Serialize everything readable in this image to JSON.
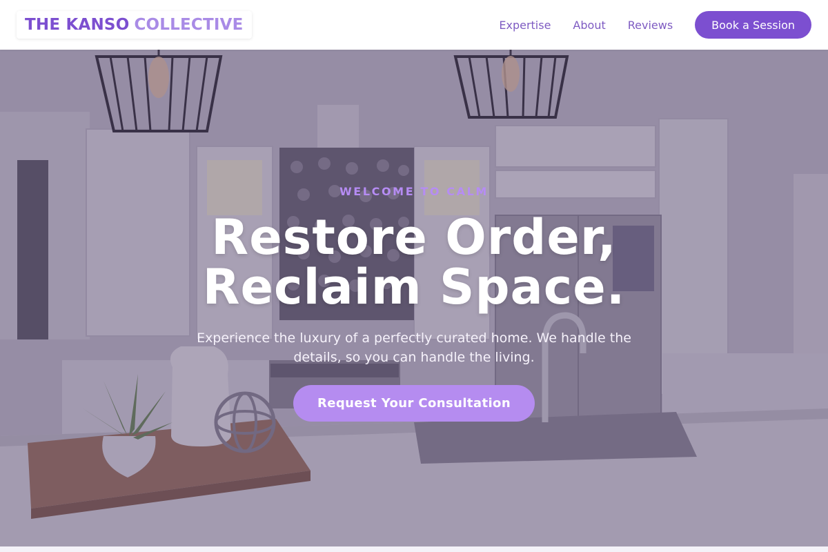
{
  "brand": {
    "name_part1": "THE KANSO",
    "name_part2": "COLLECTIVE",
    "primary_color": "#7c4fd0",
    "secondary_color": "#a98be6"
  },
  "nav": {
    "items": [
      {
        "label": "Expertise"
      },
      {
        "label": "About"
      },
      {
        "label": "Reviews"
      }
    ],
    "cta_label": "Book a Session"
  },
  "hero": {
    "eyebrow": "WELCOME TO CALM",
    "headline_line1": "Restore Order,",
    "headline_line2": "Reclaim Space.",
    "subtext": "Experience the luxury of a perfectly curated home. We handle the details, so you can handle the living.",
    "cta_label": "Request Your Consultation",
    "background_image": "kitchen-interior-photo",
    "accent_color": "#b58cf0"
  }
}
